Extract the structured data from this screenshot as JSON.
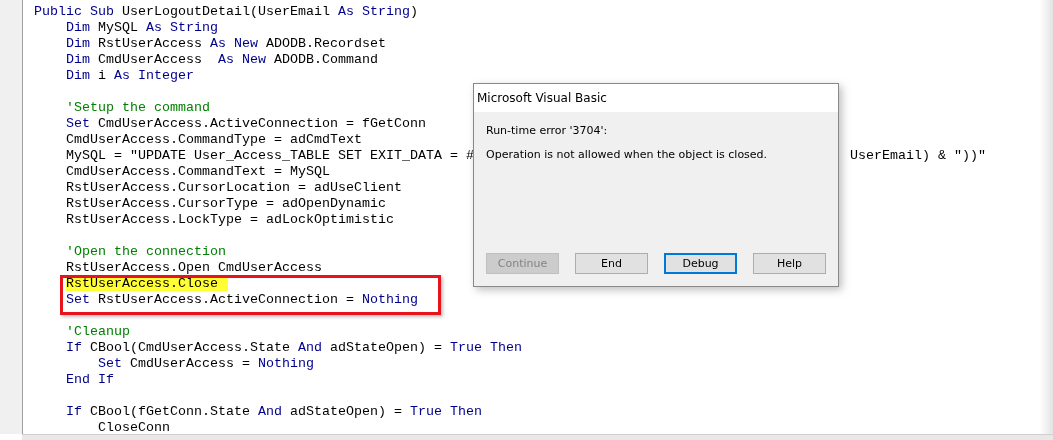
{
  "code_lines": [
    {
      "kind": "code",
      "segments": [
        {
          "kind": "keyword",
          "text": "Public Sub"
        },
        {
          "kind": "plain",
          "text": " UserLogoutDetail(UserEmail "
        },
        {
          "kind": "keyword",
          "text": "As String"
        },
        {
          "kind": "plain",
          "text": ")"
        }
      ]
    },
    {
      "kind": "code",
      "segments": [
        {
          "kind": "keyword",
          "text": "    Dim"
        },
        {
          "kind": "plain",
          "text": " MySQL "
        },
        {
          "kind": "keyword",
          "text": "As String"
        }
      ]
    },
    {
      "kind": "code",
      "segments": [
        {
          "kind": "keyword",
          "text": "    Dim"
        },
        {
          "kind": "plain",
          "text": " RstUserAccess "
        },
        {
          "kind": "keyword",
          "text": "As New"
        },
        {
          "kind": "plain",
          "text": " ADODB.Recordset"
        }
      ]
    },
    {
      "kind": "code",
      "segments": [
        {
          "kind": "keyword",
          "text": "    Dim"
        },
        {
          "kind": "plain",
          "text": " CmdUserAccess  "
        },
        {
          "kind": "keyword",
          "text": "As New"
        },
        {
          "kind": "plain",
          "text": " ADODB.Command"
        }
      ]
    },
    {
      "kind": "code",
      "segments": [
        {
          "kind": "keyword",
          "text": "    Dim"
        },
        {
          "kind": "plain",
          "text": " i "
        },
        {
          "kind": "keyword",
          "text": "As Integer"
        }
      ]
    },
    {
      "kind": "blank"
    },
    {
      "kind": "code",
      "segments": [
        {
          "kind": "comment",
          "text": "    'Setup the command"
        }
      ]
    },
    {
      "kind": "code",
      "segments": [
        {
          "kind": "keyword",
          "text": "    Set"
        },
        {
          "kind": "plain",
          "text": " CmdUserAccess.ActiveConnection = fGetConn"
        }
      ]
    },
    {
      "kind": "code",
      "segments": [
        {
          "kind": "plain",
          "text": "    CmdUserAccess.CommandType = adCmdText"
        }
      ]
    },
    {
      "kind": "split",
      "segments": [
        {
          "kind": "plain",
          "text": "    MySQL = \"UPDATE User_Access_TABLE SET EXIT_DATA = #"
        }
      ],
      "tail": "UserEmail) & \"))\""
    },
    {
      "kind": "code",
      "segments": [
        {
          "kind": "plain",
          "text": "    CmdUserAccess.CommandText = MySQL"
        }
      ]
    },
    {
      "kind": "code",
      "segments": [
        {
          "kind": "plain",
          "text": "    RstUserAccess.CursorLocation = adUseClient"
        }
      ]
    },
    {
      "kind": "code",
      "segments": [
        {
          "kind": "plain",
          "text": "    RstUserAccess.CursorType = adOpenDynamic"
        }
      ]
    },
    {
      "kind": "code",
      "segments": [
        {
          "kind": "plain",
          "text": "    RstUserAccess.LockType = adLockOptimistic"
        }
      ]
    },
    {
      "kind": "blank"
    },
    {
      "kind": "code",
      "segments": [
        {
          "kind": "comment",
          "text": "    'Open the connection"
        }
      ]
    },
    {
      "kind": "code",
      "segments": [
        {
          "kind": "plain",
          "text": "    RstUserAccess.Open CmdUserAccess"
        }
      ]
    },
    {
      "kind": "code",
      "boxed": true,
      "execution_point": true,
      "segments": [
        {
          "kind": "plain",
          "text": "    RstUserAccess.Close"
        }
      ]
    },
    {
      "kind": "code",
      "boxed": true,
      "segments": [
        {
          "kind": "keyword",
          "text": "    Set"
        },
        {
          "kind": "plain",
          "text": " RstUserAccess.ActiveConnection = "
        },
        {
          "kind": "keyword",
          "text": "Nothing"
        }
      ]
    },
    {
      "kind": "blank"
    },
    {
      "kind": "code",
      "segments": [
        {
          "kind": "comment",
          "text": "    'Cleanup"
        }
      ]
    },
    {
      "kind": "code",
      "segments": [
        {
          "kind": "keyword",
          "text": "    If"
        },
        {
          "kind": "plain",
          "text": " CBool(CmdUserAccess.State "
        },
        {
          "kind": "keyword",
          "text": "And"
        },
        {
          "kind": "plain",
          "text": " adStateOpen) = "
        },
        {
          "kind": "keyword",
          "text": "True Then"
        }
      ]
    },
    {
      "kind": "code",
      "segments": [
        {
          "kind": "keyword",
          "text": "        Set"
        },
        {
          "kind": "plain",
          "text": " CmdUserAccess = "
        },
        {
          "kind": "keyword",
          "text": "Nothing"
        }
      ]
    },
    {
      "kind": "code",
      "segments": [
        {
          "kind": "keyword",
          "text": "    End If"
        }
      ]
    },
    {
      "kind": "blank"
    },
    {
      "kind": "code",
      "segments": [
        {
          "kind": "keyword",
          "text": "    If"
        },
        {
          "kind": "plain",
          "text": " CBool(fGetConn.State "
        },
        {
          "kind": "keyword",
          "text": "And"
        },
        {
          "kind": "plain",
          "text": " adStateOpen) = "
        },
        {
          "kind": "keyword",
          "text": "True Then"
        }
      ]
    },
    {
      "kind": "code",
      "segments": [
        {
          "kind": "plain",
          "text": "        CloseConn"
        }
      ]
    }
  ],
  "dialog": {
    "title": "Microsoft Visual Basic",
    "error": "Run-time error '3704':",
    "message": "Operation is not allowed when the object is closed.",
    "buttons": [
      {
        "label": "Continue",
        "disabled": true,
        "focused": false
      },
      {
        "label": "End",
        "disabled": false,
        "focused": false
      },
      {
        "label": "Debug",
        "disabled": false,
        "focused": true
      },
      {
        "label": "Help",
        "disabled": false,
        "focused": false
      }
    ]
  }
}
